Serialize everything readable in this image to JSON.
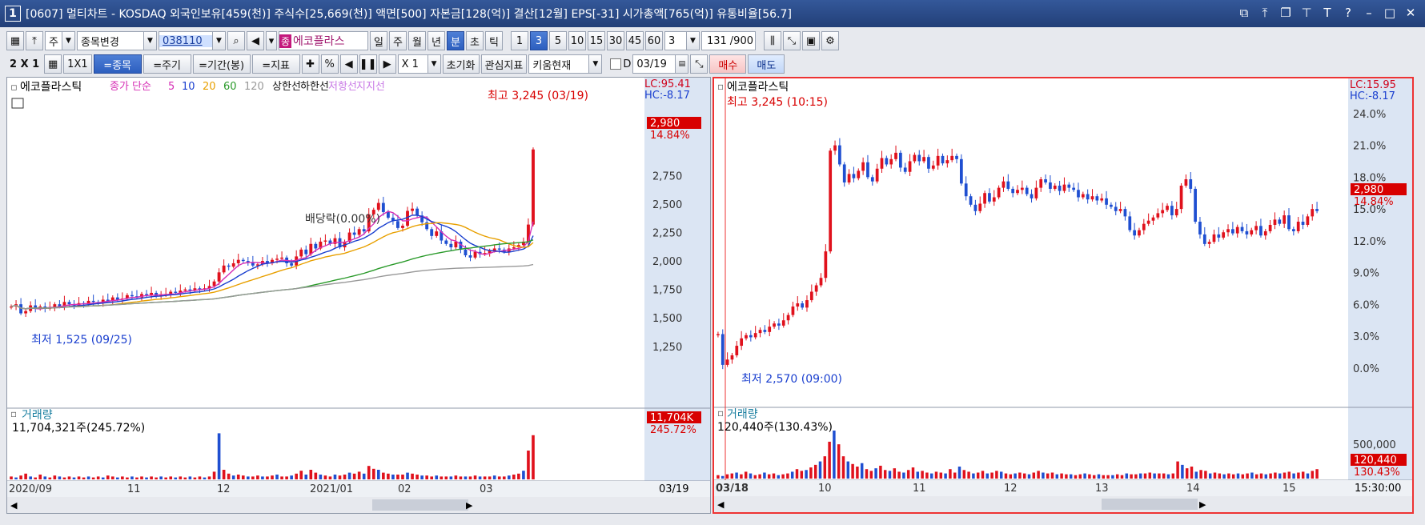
{
  "window": {
    "number": "1",
    "title": "[0607] 멀티차트 - KOSDAQ 외국인보유[459(천)] 주식수[25,669(천)] 액면[500] 자본금[128(억)] 결산[12월] EPS[-31] 시가총액[765(억)] 유통비율[56.7]",
    "buttons": [
      "restore-icon",
      "pin-icon",
      "tile-icon",
      "top-icon",
      "font-icon",
      "help-icon",
      "minimize-icon",
      "maximize-icon",
      "close-icon"
    ]
  },
  "toolbar1": {
    "type_select": "주",
    "stock_change": "종목변경",
    "code": "038110",
    "stock_badge": "종",
    "stock_name": "에코플라스",
    "periods": [
      "일",
      "주",
      "월",
      "년",
      "분",
      "초",
      "틱"
    ],
    "selected_period": "분",
    "intervals": [
      "1",
      "3",
      "5",
      "10",
      "15",
      "30",
      "45",
      "60"
    ],
    "selected_interval": "3",
    "interval_value": "3",
    "count": "131",
    "count_total": "/900"
  },
  "toolbar2": {
    "layout": "2 X 1",
    "layout_1x1": "1X1",
    "btn_stock": "=종목",
    "btn_period": "=주기",
    "btn_range": "=기간(봉)",
    "btn_indicator": "=지표",
    "zoom": "X 1",
    "reset": "초기화",
    "fav_indicator": "관심지표",
    "kiwoom": "키움현재",
    "date_label": "D",
    "date_value": "03/19",
    "buy": "매수",
    "sell": "매도"
  },
  "chart_data": [
    {
      "type": "candlestick",
      "title": "에코플라스틱",
      "legend": [
        {
          "label": "종가 단순",
          "color": "#d62fb5"
        },
        {
          "label": "5",
          "color": "#d62fb5"
        },
        {
          "label": "10",
          "color": "#1a3fcf"
        },
        {
          "label": "20",
          "color": "#e8a000"
        },
        {
          "label": "60",
          "color": "#2a9a2a"
        },
        {
          "label": "120",
          "color": "#999999"
        },
        {
          "label": "상한선",
          "color": "#111111"
        },
        {
          "label": "하한선",
          "color": "#111111"
        },
        {
          "label": "저항선",
          "color": "#c879e6"
        },
        {
          "label": "지지선",
          "color": "#c879e6"
        }
      ],
      "y_ticks": [
        "2,980",
        "2,750",
        "2,500",
        "2,250",
        "2,000",
        "1,750",
        "1,500",
        "1,250"
      ],
      "ylim": [
        1150,
        3400
      ],
      "lc": "LC:95.41",
      "hc": "HC:-8.17",
      "current_price": "2,980",
      "current_pct": "14.84%",
      "high_label": "최고 3,245 (03/19)",
      "low_label": "최저 1,525 (09/25)",
      "dividend_label": "배당락(0.00%)",
      "x_labels": [
        "2020/09",
        "11",
        "12",
        "2021/01",
        "02",
        "03"
      ],
      "x_current": "03/19",
      "close": [
        1600,
        1620,
        1540,
        1560,
        1610,
        1580,
        1600,
        1580,
        1590,
        1620,
        1600,
        1640,
        1620,
        1610,
        1630,
        1620,
        1650,
        1640,
        1630,
        1660,
        1650,
        1680,
        1660,
        1670,
        1700,
        1690,
        1680,
        1710,
        1700,
        1720,
        1690,
        1700,
        1710,
        1730,
        1720,
        1740,
        1750,
        1740,
        1760,
        1750,
        1760,
        1780,
        1820,
        1900,
        1960,
        1950,
        1980,
        2010,
        2000,
        1990,
        1960,
        1970,
        2000,
        1980,
        2010,
        2020,
        2030,
        1980,
        1960,
        2040,
        2100,
        2060,
        2150,
        2110,
        2170,
        2180,
        2150,
        2200,
        2120,
        2170,
        2250,
        2230,
        2280,
        2260,
        2410,
        2450,
        2510,
        2430,
        2380,
        2350,
        2290,
        2310,
        2440,
        2460,
        2400,
        2340,
        2280,
        2220,
        2260,
        2180,
        2150,
        2120,
        2170,
        2100,
        2050,
        2030,
        2080,
        2060,
        2070,
        2090,
        2110,
        2100,
        2080,
        2110,
        2120,
        2140,
        2170,
        2320,
        2980
      ]
    },
    {
      "type": "bar",
      "title": "거래량",
      "volume_label": "11,704,321주(245.72%)",
      "current": "11,704K",
      "current_pct": "245.72%",
      "values": [
        0.3,
        0.2,
        0.4,
        0.6,
        0.3,
        0.2,
        0.5,
        0.3,
        0.2,
        0.4,
        0.3,
        0.2,
        0.3,
        0.2,
        0.3,
        0.2,
        0.3,
        0.2,
        0.3,
        0.2,
        0.4,
        0.3,
        0.2,
        0.3,
        0.2,
        0.3,
        0.2,
        0.3,
        0.2,
        0.3,
        0.2,
        0.3,
        0.2,
        0.3,
        0.2,
        0.3,
        0.2,
        0.3,
        0.2,
        0.3,
        0.2,
        0.3,
        0.8,
        4.8,
        1.0,
        0.6,
        0.4,
        0.5,
        0.4,
        0.3,
        0.3,
        0.4,
        0.3,
        0.3,
        0.4,
        0.5,
        0.3,
        0.3,
        0.4,
        0.6,
        0.9,
        0.5,
        1.0,
        0.7,
        0.5,
        0.4,
        0.3,
        0.5,
        0.4,
        0.5,
        0.7,
        0.6,
        0.8,
        0.6,
        1.4,
        1.1,
        1.0,
        0.7,
        0.6,
        0.5,
        0.5,
        0.5,
        0.7,
        0.6,
        0.5,
        0.4,
        0.4,
        0.3,
        0.4,
        0.3,
        0.3,
        0.3,
        0.4,
        0.3,
        0.3,
        0.3,
        0.4,
        0.3,
        0.3,
        0.3,
        0.4,
        0.3,
        0.3,
        0.4,
        0.5,
        0.6,
        0.9,
        3.0,
        4.6
      ]
    },
    {
      "type": "candlestick",
      "title": "에코플라스틱",
      "y_ticks": [
        "24.0%",
        "21.0%",
        "18.0%",
        "15.0%",
        "12.0%",
        "9.0%",
        "6.0%",
        "3.0%",
        "0.0%"
      ],
      "ylim": [
        -2.5,
        25.8
      ],
      "lc": "LC:15.95",
      "hc": "HC:-8.17",
      "current_price": "2,980",
      "current_pct": "14.84%",
      "high_label": "최고 3,245 (10:15)",
      "low_label": "최저 2,570 (09:00)",
      "x_labels": [
        "03/18",
        "10",
        "11",
        "12",
        "13",
        "14",
        "15"
      ],
      "x_current": "15:30:00",
      "close_pct": [
        3.2,
        0.3,
        0.8,
        1.2,
        2.1,
        2.8,
        3.1,
        2.9,
        3.3,
        3.6,
        3.4,
        3.9,
        4.2,
        4.0,
        4.5,
        5.0,
        5.8,
        6.1,
        5.7,
        6.4,
        7.2,
        7.8,
        8.5,
        11.0,
        20.5,
        21.0,
        19.2,
        17.5,
        18.3,
        17.9,
        18.6,
        19.4,
        18.0,
        17.6,
        18.8,
        19.8,
        19.2,
        19.7,
        20.3,
        18.9,
        18.5,
        19.5,
        20.1,
        19.5,
        19.9,
        18.8,
        19.1,
        20.0,
        19.3,
        19.6,
        20.0,
        19.7,
        17.4,
        16.2,
        15.4,
        14.8,
        15.5,
        16.5,
        15.7,
        16.1,
        17.0,
        17.6,
        16.9,
        16.5,
        16.8,
        17.0,
        16.4,
        16.0,
        17.0,
        17.8,
        17.5,
        16.9,
        17.2,
        16.7,
        17.3,
        17.0,
        16.8,
        16.1,
        16.4,
        15.9,
        16.2,
        15.8,
        16.0,
        15.4,
        15.2,
        14.8,
        15.0,
        14.3,
        13.0,
        12.5,
        13.0,
        13.6,
        13.9,
        14.2,
        14.6,
        14.9,
        15.3,
        14.4,
        15.0,
        17.2,
        17.8,
        16.9,
        13.8,
        12.6,
        11.7,
        11.9,
        12.6,
        12.3,
        12.8,
        13.1,
        12.7,
        13.3,
        12.9,
        12.6,
        13.0,
        13.4,
        12.5,
        12.9,
        13.5,
        14.0,
        13.6,
        14.4,
        13.1,
        12.9,
        13.8,
        13.5,
        14.3,
        15.0,
        14.8
      ]
    },
    {
      "type": "bar",
      "title": "거래량",
      "volume_label": "120,440주(130.43%)",
      "y_ticks": [
        "500,000"
      ],
      "current": "120,440",
      "current_pct": "130.43%",
      "values": [
        0.4,
        0.3,
        0.5,
        0.6,
        0.7,
        0.5,
        0.8,
        0.6,
        0.4,
        0.5,
        0.7,
        0.5,
        0.6,
        0.4,
        0.5,
        0.6,
        0.8,
        1.1,
        0.9,
        1.0,
        1.3,
        1.6,
        2.0,
        2.6,
        4.3,
        5.6,
        4.0,
        2.6,
        2.0,
        1.7,
        1.4,
        1.8,
        1.1,
        0.9,
        1.2,
        1.5,
        1.0,
        0.9,
        1.2,
        0.8,
        0.7,
        1.0,
        1.3,
        0.8,
        0.9,
        0.7,
        0.6,
        0.8,
        0.7,
        0.6,
        1.1,
        0.7,
        1.4,
        1.0,
        0.8,
        0.6,
        0.7,
        0.9,
        0.6,
        0.7,
        0.9,
        0.8,
        0.6,
        0.5,
        0.6,
        0.7,
        0.6,
        0.5,
        0.7,
        0.9,
        0.7,
        0.6,
        0.7,
        0.5,
        0.6,
        0.5,
        0.5,
        0.4,
        0.5,
        0.6,
        0.5,
        0.4,
        0.5,
        0.4,
        0.4,
        0.4,
        0.5,
        0.4,
        0.6,
        0.5,
        0.5,
        0.6,
        0.6,
        0.7,
        0.6,
        0.6,
        0.6,
        0.5,
        0.6,
        2.0,
        1.6,
        1.2,
        1.4,
        0.8,
        1.0,
        0.9,
        0.6,
        0.7,
        0.6,
        0.5,
        0.6,
        0.5,
        0.6,
        0.5,
        0.6,
        0.7,
        0.5,
        0.6,
        0.5,
        0.6,
        0.7,
        0.6,
        0.7,
        0.8,
        0.6,
        0.7,
        0.8,
        0.6,
        0.9,
        1.1
      ]
    }
  ]
}
